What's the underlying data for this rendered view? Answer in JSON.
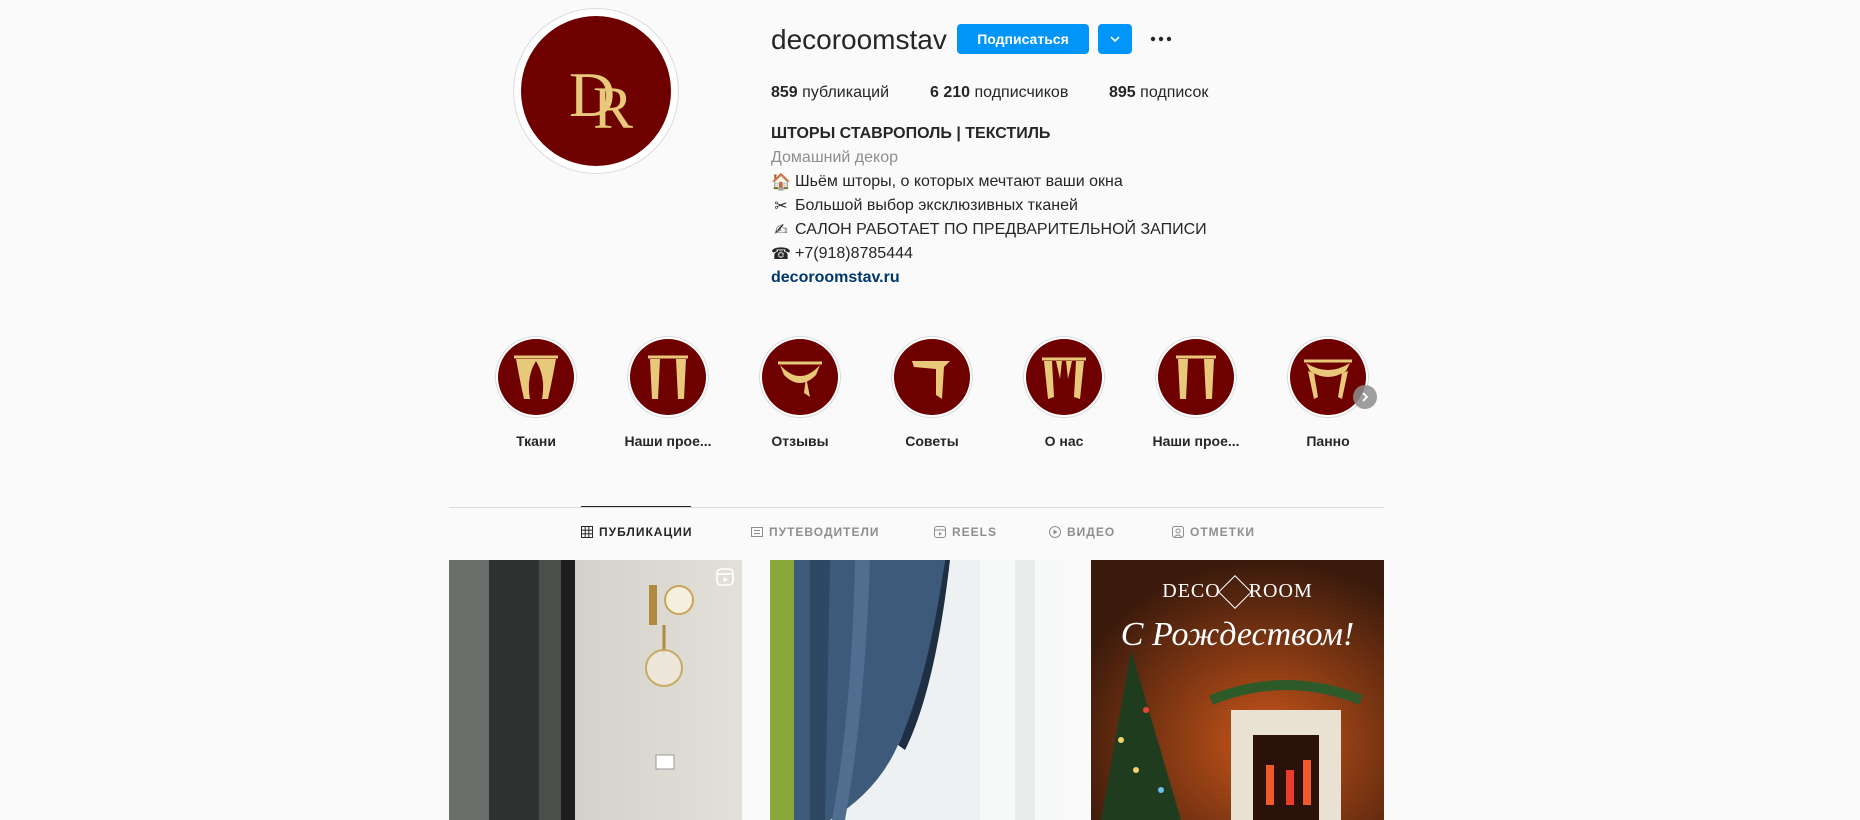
{
  "profile": {
    "username": "decoroomstav",
    "follow_label": "Подписаться",
    "logo_text": "DR",
    "stats": [
      {
        "count": "859",
        "label": "публикаций"
      },
      {
        "count": "6 210",
        "label": "подписчиков"
      },
      {
        "count": "895",
        "label": "подписок"
      }
    ],
    "bio": {
      "name": "ШТОРЫ СТАВРОПОЛЬ | ТЕКСТИЛЬ",
      "category": "Домашний декор",
      "lines": [
        {
          "emoji": "🏠",
          "text": "Шьём шторы, о которых мечтают ваши окна"
        },
        {
          "emoji": "✂",
          "text": "Большой выбор эксклюзивных тканей"
        },
        {
          "emoji": "✍",
          "text": "САЛОН РАБОТАЕТ ПО ПРЕДВАРИТЕЛЬНОЙ ЗАПИСИ"
        },
        {
          "emoji": "☎",
          "text": "+7(918)8785444"
        }
      ],
      "link": "decoroomstav.ru"
    }
  },
  "highlights": [
    {
      "label": "Ткани"
    },
    {
      "label": "Наши прое..."
    },
    {
      "label": "Отзывы"
    },
    {
      "label": "Советы"
    },
    {
      "label": "О нас"
    },
    {
      "label": "Наши прое..."
    },
    {
      "label": "Панно"
    }
  ],
  "tabs": [
    {
      "label": "ПУБЛИКАЦИИ",
      "active": true,
      "icon": "grid-icon"
    },
    {
      "label": "ПУТЕВОДИТЕЛИ",
      "active": false,
      "icon": "guide-icon"
    },
    {
      "label": "REELS",
      "active": false,
      "icon": "reels-icon"
    },
    {
      "label": "ВИДЕО",
      "active": false,
      "icon": "video-icon"
    },
    {
      "label": "ОТМЕТКИ",
      "active": false,
      "icon": "tag-icon"
    }
  ],
  "posts": [
    {
      "type": "reel",
      "icon": "reels-icon"
    },
    {
      "type": "photo"
    },
    {
      "type": "photo",
      "brand_text": "DECO",
      "brand_text2": "ROOM",
      "caption": "С Рождеством!"
    }
  ],
  "colors": {
    "accent": "#0095f6",
    "brand_maroon": "#6e0000",
    "logo_gold": "#e8c97a",
    "link": "#00376b"
  }
}
